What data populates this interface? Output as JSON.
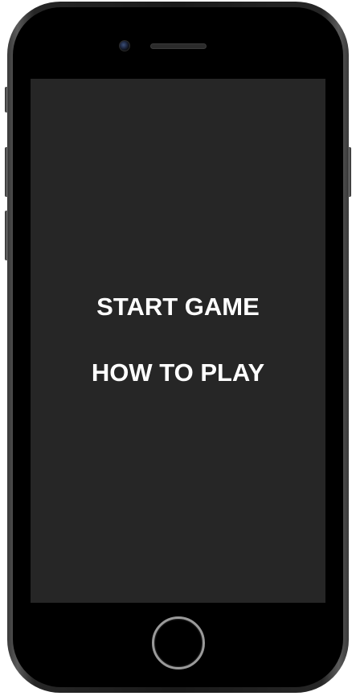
{
  "menu": {
    "items": [
      {
        "label": "START GAME"
      },
      {
        "label": "HOW TO PLAY"
      }
    ]
  },
  "colors": {
    "screen_background": "#262626",
    "menu_text": "#ffffff",
    "device_body": "#000000"
  },
  "icons": {
    "front_camera": "front-camera-icon",
    "earpiece": "earpiece-speaker-icon",
    "home": "home-button-icon"
  }
}
